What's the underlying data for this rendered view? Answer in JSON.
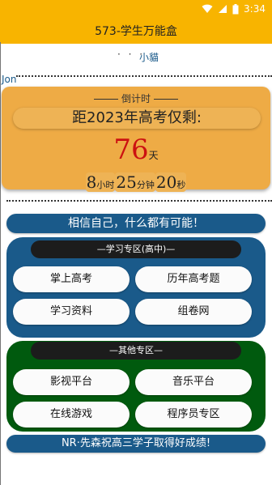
{
  "status_bar": {
    "time": "3:34"
  },
  "app_bar": {
    "title": "573-学生万能盒"
  },
  "user": {
    "dots": "· · ·",
    "name": "小貓",
    "handle": "Jon"
  },
  "countdown": {
    "label": "倒计时",
    "heading": "距2023年高考仅剩:",
    "days": "76",
    "days_unit": "天",
    "hours": "8",
    "hours_unit": "小时",
    "minutes": "25",
    "minutes_unit": "分钟",
    "seconds": "20",
    "seconds_unit": "秒"
  },
  "motto": "相信自己，什么都有可能！",
  "study_zone": {
    "title": "—学习专区(高中)—",
    "buttons": [
      "掌上高考",
      "历年高考题",
      "学习资料",
      "组卷网"
    ]
  },
  "other_zone": {
    "title": "—其他专区—",
    "buttons": [
      "影视平台",
      "音乐平台",
      "在线游戏",
      "程序员专区"
    ]
  },
  "footer": "NR·先森祝高三学子取得好成绩!",
  "colors": {
    "appbar": "#f8b400",
    "countdown_card": "#eeab45",
    "blue": "#1a5a8a",
    "green": "#005a0e",
    "days_red": "#cc1111"
  }
}
